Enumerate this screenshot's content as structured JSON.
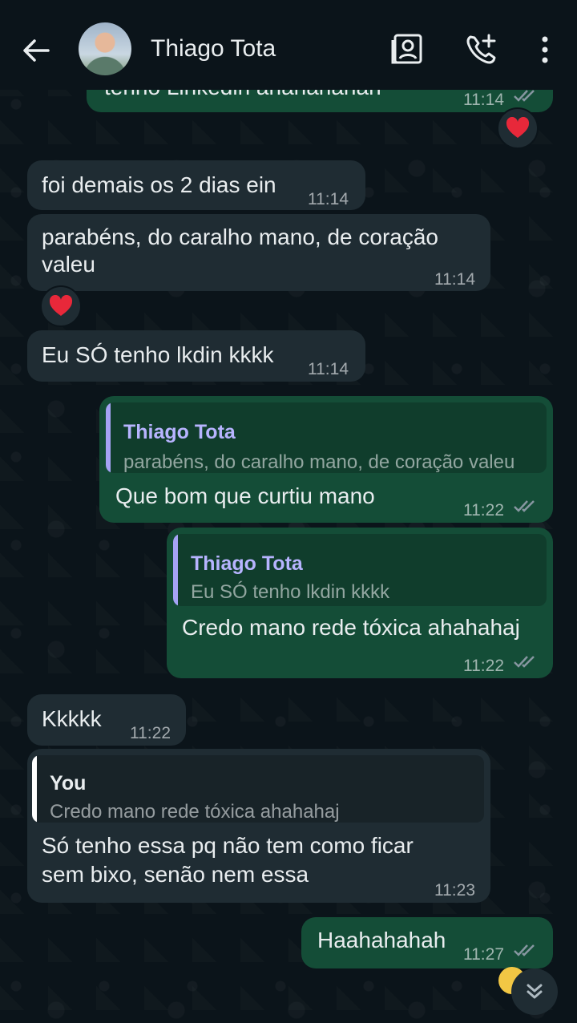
{
  "header": {
    "contact_name": "Thiago Tota",
    "icons": [
      "back-arrow-icon",
      "contact-card-icon",
      "add-call-icon",
      "more-vertical-icon"
    ]
  },
  "messages": [
    {
      "id": "m0",
      "direction": "out",
      "text": "tenho Linkedin ahahahahah",
      "time": "11:14",
      "reaction": "❤️"
    },
    {
      "id": "m1",
      "direction": "in",
      "text": "foi demais os 2 dias ein",
      "time": "11:14"
    },
    {
      "id": "m2",
      "direction": "in",
      "lines": [
        "parabéns, do caralho mano, de coração",
        "valeu"
      ],
      "time": "11:14",
      "reaction": "❤️"
    },
    {
      "id": "m3",
      "direction": "in",
      "text": "Eu SÓ tenho lkdin kkkk",
      "time": "11:14"
    },
    {
      "id": "m4",
      "direction": "out",
      "quote_author": "Thiago Tota",
      "quote_text": "parabéns, do caralho mano, de coração valeu",
      "text": "Que bom que curtiu mano",
      "time": "11:22"
    },
    {
      "id": "m5",
      "direction": "out",
      "quote_author": "Thiago Tota",
      "quote_text": "Eu SÓ tenho lkdin kkkk",
      "text": "Credo mano rede tóxica ahahahaj",
      "time": "11:22"
    },
    {
      "id": "m6",
      "direction": "in",
      "text": "Kkkkk",
      "time": "11:22"
    },
    {
      "id": "m7",
      "direction": "in",
      "quote_author": "You",
      "quote_text": "Credo mano rede tóxica ahahahaj",
      "lines": [
        "Só tenho essa pq não tem como ficar",
        "sem bixo, senão nem essa"
      ],
      "time": "11:23"
    },
    {
      "id": "m8",
      "direction": "out",
      "text": "Haahahahah",
      "time": "11:27"
    }
  ],
  "colors": {
    "background": "#0b141a",
    "incoming_bubble": "#1f2c33",
    "outgoing_bubble": "#144d37",
    "quote_accent": "#a5a3f5",
    "tick_read": "#8696a0"
  }
}
